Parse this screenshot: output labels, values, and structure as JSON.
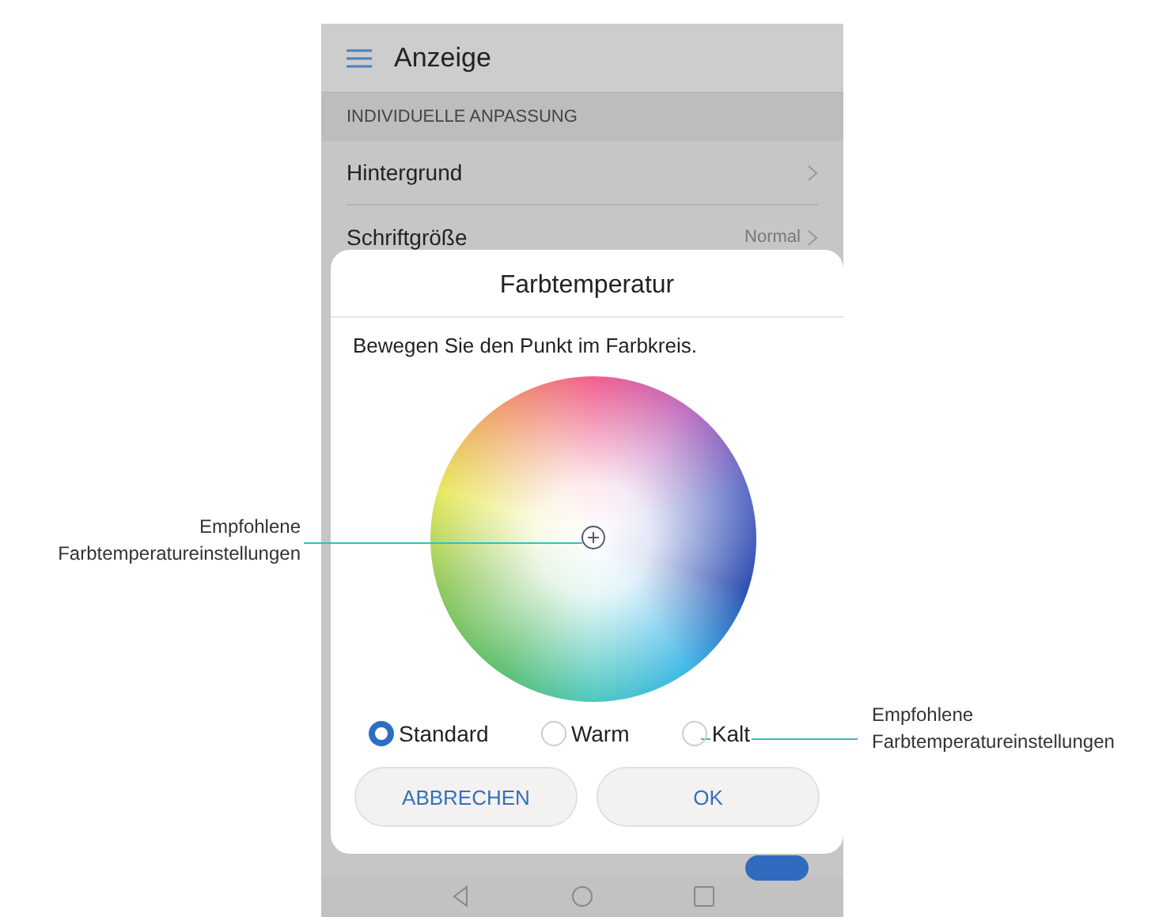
{
  "screen": {
    "title": "Anzeige",
    "section": "INDIVIDUELLE ANPASSUNG",
    "rows": [
      {
        "label": "Hintergrund"
      },
      {
        "label": "Schriftgröße",
        "value": "Normal"
      }
    ],
    "toggle": {
      "on": true
    }
  },
  "dialog": {
    "title": "Farbtemperatur",
    "instruction": "Bewegen Sie den Punkt im Farbkreis.",
    "options": [
      {
        "label": "Standard",
        "selected": true
      },
      {
        "label": "Warm",
        "selected": false
      },
      {
        "label": "Kalt",
        "selected": false
      }
    ],
    "buttons": [
      "ABBRECHEN",
      "OK"
    ]
  },
  "callouts": [
    {
      "lines": [
        "Empfohlene",
        "Farbtemperatureinstellungen"
      ]
    },
    {
      "lines": [
        "Empfohlene",
        "Farbtemperatureinstellungen"
      ]
    }
  ]
}
